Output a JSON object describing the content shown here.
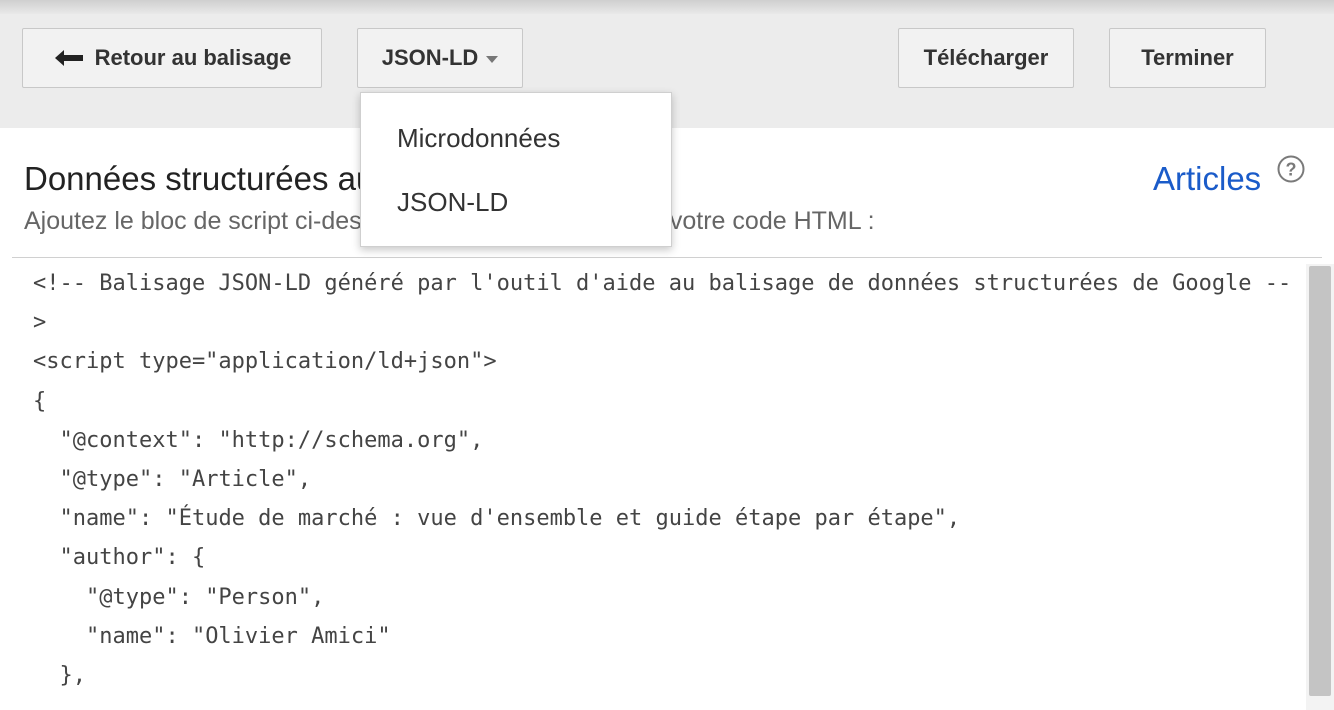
{
  "toolbar": {
    "back_label": "Retour au balisage",
    "format_label": "JSON-LD",
    "download_label": "Télécharger",
    "finish_label": "Terminer"
  },
  "format_menu": {
    "items": [
      "Microdonnées",
      "JSON-LD"
    ],
    "selected": "JSON-LD"
  },
  "main": {
    "heading": "Données structurées au format JSON-LD",
    "subheading": "Ajoutez le bloc de script ci-dessous à la section \"head\" de votre code HTML :",
    "type_link": "Articles",
    "code": "<!-- Balisage JSON-LD généré par l'outil d'aide au balisage de données structurées de Google -->\n<script type=\"application/ld+json\">\n{\n  \"@context\": \"http://schema.org\",\n  \"@type\": \"Article\",\n  \"name\": \"Étude de marché : vue d'ensemble et guide étape par étape\",\n  \"author\": {\n    \"@type\": \"Person\",\n    \"name\": \"Olivier Amici\"\n  },"
  },
  "icons": {
    "back": "back-arrow-icon",
    "format": "chevron-down-icon",
    "help": "help-circle-icon"
  },
  "colors": {
    "link": "#1a5bc9",
    "toolbar_bg": "#ececec",
    "button_bg": "#f2f2f2"
  }
}
